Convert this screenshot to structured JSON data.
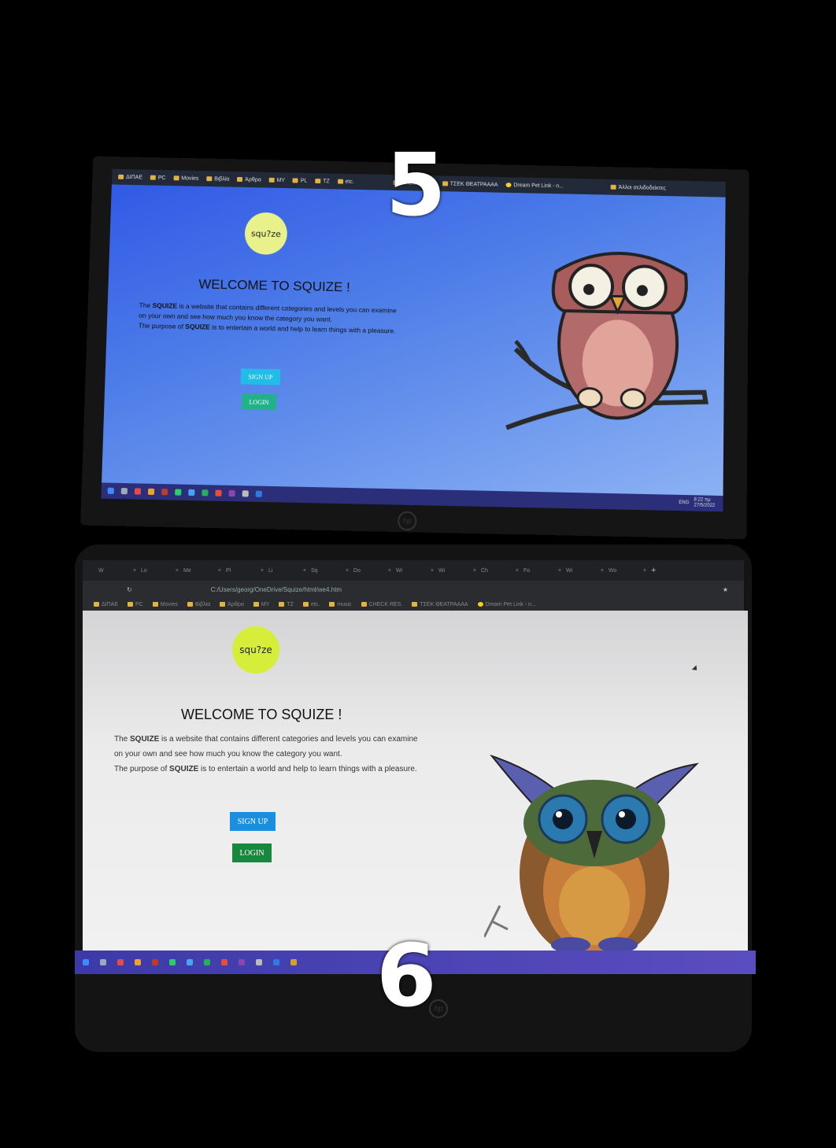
{
  "labels": {
    "top": "5",
    "bottom": "6"
  },
  "bookmarks_top": [
    "ΔΙΠΑΕ",
    "PC",
    "Movies",
    "Βιβλία",
    "Άρθρα",
    "MY",
    "PL",
    "TZ",
    "etc.",
    "CHECK RES.",
    "ΤΣΕΚ ΘΕΑΤΡΑΑΑΑ",
    "Dream Pet Link - n...",
    "Άλλοι σελιδοδείκτες"
  ],
  "bookmarks_bottom": [
    "ΔΙΠΑΕ",
    "PC",
    "Movies",
    "Βιβλία",
    "Άρθρα",
    "MY",
    "TZ",
    "etc.",
    "music",
    "CHECK RES.",
    "ΤΣΕΚ ΘΕΑΤΡΑΑΑΑ",
    "Dream Pet Link - n..."
  ],
  "tabs": [
    "W",
    "Lo",
    "Me",
    "Pl",
    "Li",
    "Sq",
    "Do",
    "Wi",
    "Wi",
    "Ch",
    "Fo",
    "Wi",
    "Wo"
  ],
  "address": "C:/Users/georg/OneDrive/Squize/html/we4.htm",
  "page": {
    "logo_text": "squ?ze",
    "welcome": "WELCOME TO SQUIZE !",
    "p1_pre": "The ",
    "p1_bold": "SQUIZE",
    "p1_post": " is a website that contains different categories and levels you can examine",
    "p2": "on your own and see how much you know the category you want.",
    "p3_pre": "The purpose of ",
    "p3_bold": "SQUIZE",
    "p3_post": " is to entertain a world and help to learn things with a pleasure.",
    "signup": "SIGN UP",
    "login": "LOGIN"
  },
  "tray": {
    "lang": "ENG",
    "time": "8:22 πμ",
    "date": "27/5/2022"
  },
  "colors": {
    "bg_top": "#3d6be6",
    "bg_bottom": "#ececec",
    "logo": "#e9f18a",
    "signup_top": "#1fbde8",
    "login_top": "#21b28a",
    "signup_bottom": "#1a8fe0",
    "login_bottom": "#17893e"
  }
}
